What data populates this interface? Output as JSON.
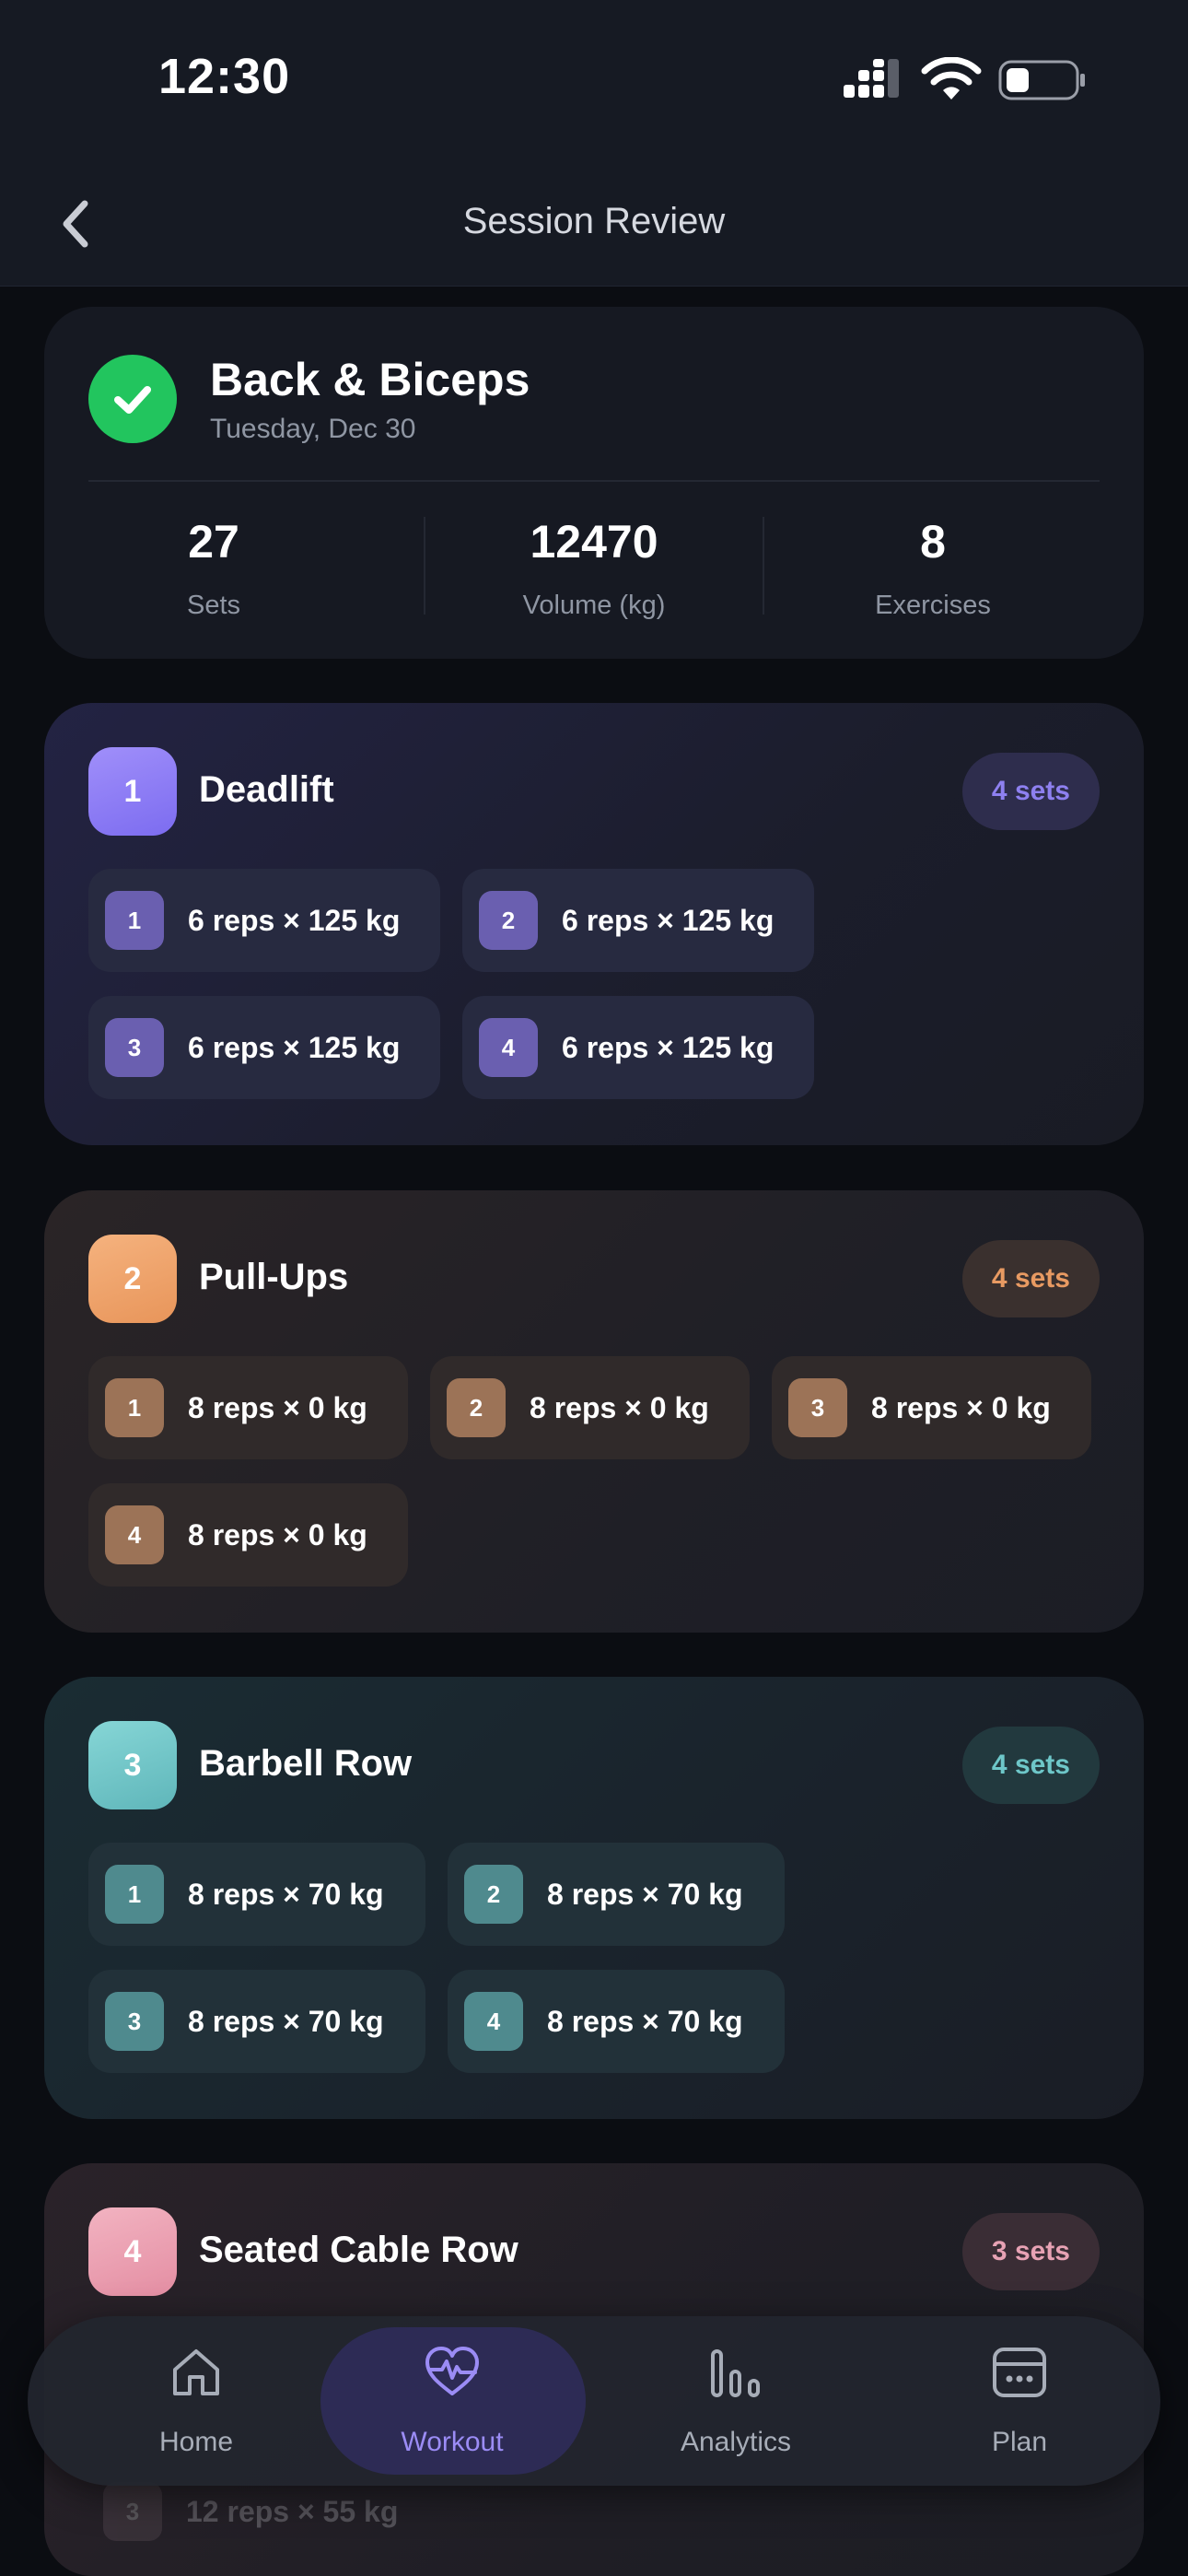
{
  "status_bar": {
    "time": "12:30"
  },
  "nav": {
    "title": "Session Review"
  },
  "summary": {
    "title": "Back & Biceps",
    "date": "Tuesday, Dec 30",
    "stats": [
      {
        "value": "27",
        "label": "Sets"
      },
      {
        "value": "12470",
        "label": "Volume (kg)"
      },
      {
        "value": "8",
        "label": "Exercises"
      }
    ]
  },
  "exercises": [
    {
      "number": "1",
      "name": "Deadlift",
      "badge": "4 sets",
      "accent": "#8b7cf6",
      "sets": [
        {
          "n": "1",
          "text": "6 reps × 125 kg"
        },
        {
          "n": "2",
          "text": "6 reps × 125 kg"
        },
        {
          "n": "3",
          "text": "6 reps × 125 kg"
        },
        {
          "n": "4",
          "text": "6 reps × 125 kg"
        }
      ]
    },
    {
      "number": "2",
      "name": "Pull-Ups",
      "badge": "4 sets",
      "accent": "#f0a46a",
      "sets": [
        {
          "n": "1",
          "text": "8 reps × 0 kg"
        },
        {
          "n": "2",
          "text": "8 reps × 0 kg"
        },
        {
          "n": "3",
          "text": "8 reps × 0 kg"
        },
        {
          "n": "4",
          "text": "8 reps × 0 kg"
        }
      ]
    },
    {
      "number": "3",
      "name": "Barbell Row",
      "badge": "4 sets",
      "accent": "#6ec7c9",
      "sets": [
        {
          "n": "1",
          "text": "8 reps × 70 kg"
        },
        {
          "n": "2",
          "text": "8 reps × 70 kg"
        },
        {
          "n": "3",
          "text": "8 reps × 70 kg"
        },
        {
          "n": "4",
          "text": "8 reps × 70 kg"
        }
      ]
    },
    {
      "number": "4",
      "name": "Seated Cable Row",
      "badge": "3 sets",
      "accent": "#ec9fb0",
      "sets": [
        {
          "n": "3",
          "text": "12 reps × 55 kg"
        }
      ]
    }
  ],
  "tabbar": {
    "items": [
      {
        "label": "Home",
        "icon": "home-icon"
      },
      {
        "label": "Workout",
        "icon": "heart-pulse-icon",
        "active": true
      },
      {
        "label": "Analytics",
        "icon": "bar-chart-icon"
      },
      {
        "label": "Plan",
        "icon": "calendar-icon"
      }
    ]
  },
  "colors": {
    "accent": "#9b8cf5",
    "success": "#22c55e",
    "background": "#0b0d12"
  }
}
